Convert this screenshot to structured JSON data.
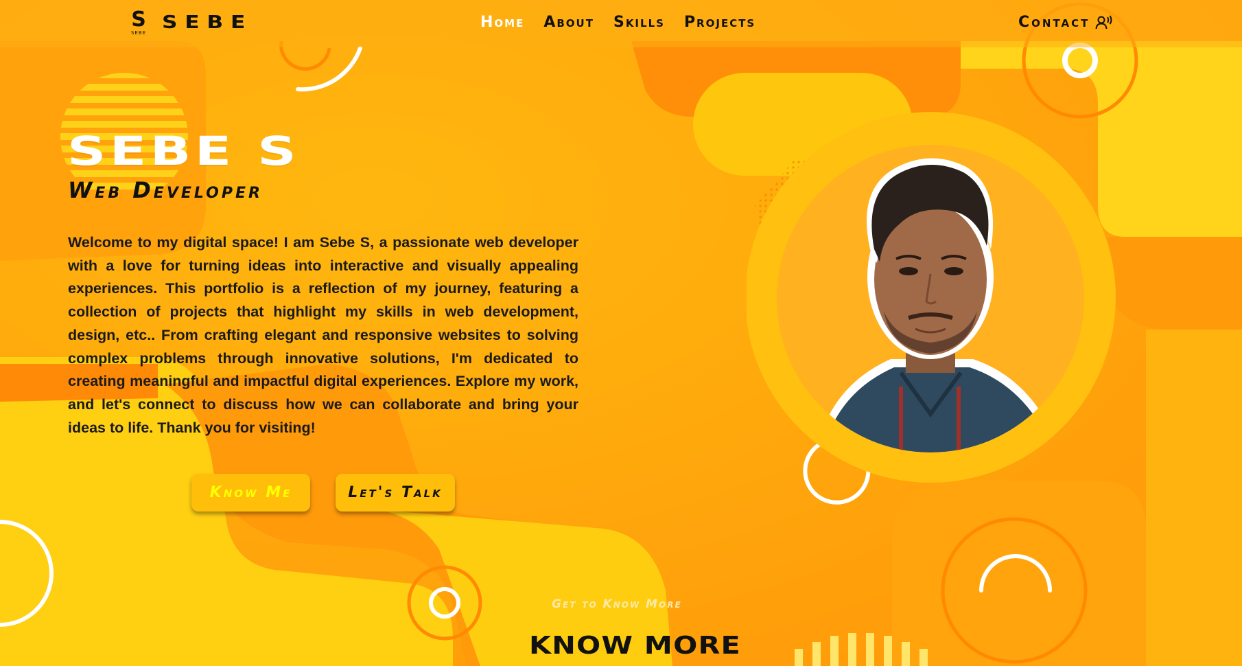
{
  "nav": {
    "logo_mark": "S",
    "logo_mark_caption": "SEBE",
    "logo_text": "SEBE",
    "links": [
      {
        "label": "Home",
        "active": true
      },
      {
        "label": "About",
        "active": false
      },
      {
        "label": "Skills",
        "active": false
      },
      {
        "label": "Projects",
        "active": false
      }
    ],
    "contact_label": "Contact",
    "contact_icon": "user-voice-icon"
  },
  "hero": {
    "name": "SEBE S",
    "role": "Web Developer",
    "description": "Welcome to my digital space! I am Sebe S, a passionate web developer with a love for turning ideas into interactive and visually appealing experiences. This portfolio is a reflection of my journey, featuring a collection of projects that highlight my skills in web development, design, etc.. From crafting elegant and responsive websites to solving complex problems through innovative solutions, I'm dedicated to creating meaningful and impactful digital experiences. Explore my work, and let's connect to discuss how we can collaborate and bring your ideas to life. Thank you for visiting!",
    "buttons": {
      "know_me": "Know Me",
      "lets_talk": "Let's Talk"
    }
  },
  "portrait": {
    "subject": "profile-photo"
  },
  "more_section": {
    "subtitle": "Get to Know More",
    "title": "KNOW MORE"
  },
  "colors": {
    "background": "#ffa60d",
    "accent_yellow": "#ffd000",
    "accent_orange": "#ff8a00",
    "button_bg": "#ffbe0a",
    "know_me_text": "#ffff00",
    "active_nav": "#ffffff",
    "text_dark": "#111111"
  }
}
